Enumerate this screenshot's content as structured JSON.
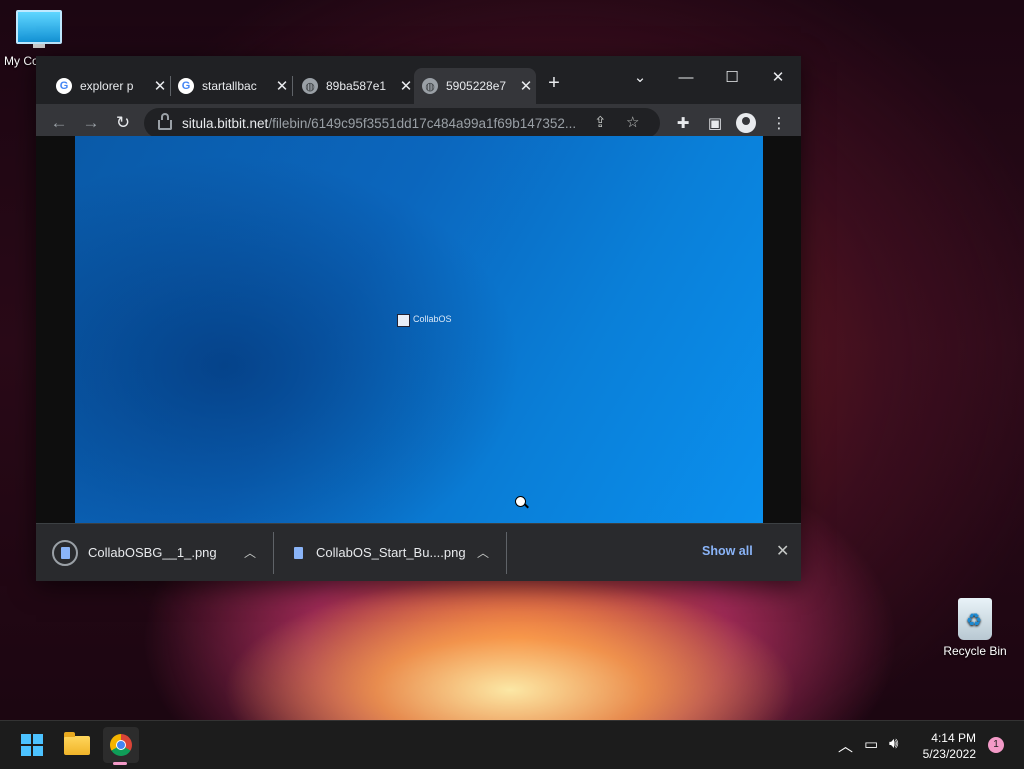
{
  "desktop": {
    "icons": [
      {
        "label": "My Co",
        "icon": "monitor-icon"
      },
      {
        "label": "Recycle Bin",
        "icon": "recycle-bin-icon"
      }
    ]
  },
  "browser": {
    "tabs": [
      {
        "title": "explorer p",
        "favicon": "google-icon",
        "active": false
      },
      {
        "title": "startallbac",
        "favicon": "google-icon",
        "active": false
      },
      {
        "title": "89ba587e1",
        "favicon": "globe-icon",
        "active": false
      },
      {
        "title": "5905228e7",
        "favicon": "globe-icon",
        "active": true
      }
    ],
    "new_tab_label": "+",
    "window_controls": {
      "minimize": "—",
      "maximize": "☐",
      "close": "✕",
      "tab_search": "⌄"
    },
    "url_host": "situla.bitbit.net",
    "url_path": "/filebin/6149c95f3551dd17c484a99a1f69b147352...",
    "page_image": {
      "label": "CollabOS"
    },
    "downloads": [
      {
        "filename": "CollabOSBG__1_.png"
      },
      {
        "filename": "CollabOS_Start_Bu....png"
      }
    ],
    "show_all_label": "Show all"
  },
  "taskbar": {
    "apps": [
      "start-icon",
      "file-explorer-icon",
      "chrome-icon"
    ],
    "time": "4:14 PM",
    "date": "5/23/2022",
    "notification_count": "1"
  }
}
